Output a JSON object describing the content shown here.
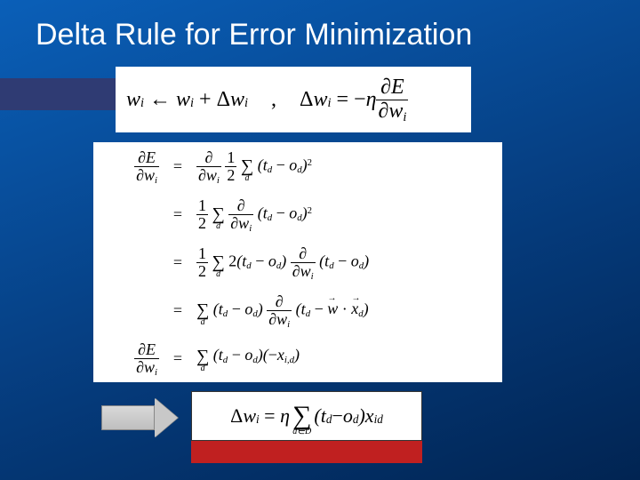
{
  "title": "Delta Rule for Error Minimization",
  "eq1": {
    "lhs_w": "w",
    "lhs_idx": "i",
    "arrow": "←",
    "plus": "+",
    "delta": "Δ",
    "comma": ",",
    "eq": "=",
    "minus": "−",
    "eta": "η",
    "partial": "∂",
    "E": "E"
  },
  "deriv": {
    "partial": "∂",
    "E": "E",
    "w": "w",
    "i": "i",
    "eq": "=",
    "half_num": "1",
    "half_den": "2",
    "sigma": "∑",
    "d": "d",
    "t": "t",
    "o": "o",
    "minus": "−",
    "two": "2",
    "sq": "2",
    "dot": "·",
    "vec_w": "w",
    "vec_x": "x",
    "x": "x",
    "comma": ",",
    "id": "i,d"
  },
  "result": {
    "delta": "Δ",
    "w": "w",
    "i": "i",
    "eq": "=",
    "eta": "η",
    "sigma": "∑",
    "idx": "d∈D",
    "t": "t",
    "d": "d",
    "minus": "−",
    "o": "o",
    "x": "x",
    "id": "id"
  }
}
